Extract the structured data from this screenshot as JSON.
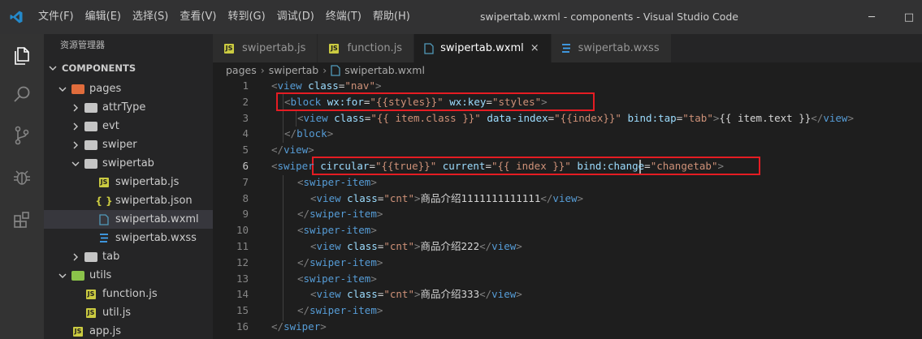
{
  "titlebar": {
    "menu": [
      "文件(F)",
      "编辑(E)",
      "选择(S)",
      "查看(V)",
      "转到(G)",
      "调试(D)",
      "终端(T)",
      "帮助(H)"
    ],
    "window_title": "swipertab.wxml - components - Visual Studio Code",
    "minimize": "─",
    "restore": "□"
  },
  "sidebar": {
    "title": "资源管理器",
    "section": "COMPONENTS",
    "tree": [
      {
        "label": "pages",
        "kind": "folder-pages",
        "expanded": true,
        "depth": 1
      },
      {
        "label": "attrType",
        "kind": "folder",
        "expanded": false,
        "depth": 2
      },
      {
        "label": "evt",
        "kind": "folder",
        "expanded": false,
        "depth": 2
      },
      {
        "label": "swiper",
        "kind": "folder",
        "expanded": false,
        "depth": 2
      },
      {
        "label": "swipertab",
        "kind": "folder",
        "expanded": true,
        "depth": 2
      },
      {
        "label": "swipertab.js",
        "kind": "js",
        "depth": 3
      },
      {
        "label": "swipertab.json",
        "kind": "json",
        "depth": 3
      },
      {
        "label": "swipertab.wxml",
        "kind": "wxml",
        "depth": 3,
        "selected": true
      },
      {
        "label": "swipertab.wxss",
        "kind": "wxss",
        "depth": 3
      },
      {
        "label": "tab",
        "kind": "folder",
        "expanded": false,
        "depth": 2
      },
      {
        "label": "utils",
        "kind": "folder-utils",
        "expanded": true,
        "depth": 1
      },
      {
        "label": "function.js",
        "kind": "js",
        "depth": 2
      },
      {
        "label": "util.js",
        "kind": "js",
        "depth": 2
      },
      {
        "label": "app.js",
        "kind": "js",
        "depth": 1
      }
    ]
  },
  "tabs": [
    {
      "label": "swipertab.js",
      "kind": "js",
      "active": false
    },
    {
      "label": "function.js",
      "kind": "js",
      "active": false
    },
    {
      "label": "swipertab.wxml",
      "kind": "wxml",
      "active": true
    },
    {
      "label": "swipertab.wxss",
      "kind": "wxss",
      "active": false
    }
  ],
  "tab_close": "×",
  "breadcrumb": [
    "pages",
    "swipertab",
    "swipertab.wxml"
  ],
  "breadcrumb_sep": "›",
  "editor": {
    "current_line": 6,
    "lines": [
      {
        "n": "1",
        "tokens": [
          [
            "bracket",
            "<"
          ],
          [
            "tag",
            "view"
          ],
          [
            "txt",
            " "
          ],
          [
            "attr",
            "class"
          ],
          [
            "txt",
            "="
          ],
          [
            "str",
            "\"nav\""
          ],
          [
            "bracket",
            ">"
          ]
        ],
        "indent": 0
      },
      {
        "n": "2",
        "tokens": [
          [
            "bracket",
            "<"
          ],
          [
            "tag",
            "block"
          ],
          [
            "txt",
            " "
          ],
          [
            "attr",
            "wx:for"
          ],
          [
            "txt",
            "="
          ],
          [
            "str",
            "\"{{styles}}\""
          ],
          [
            "txt",
            " "
          ],
          [
            "attr",
            "wx:key"
          ],
          [
            "txt",
            "="
          ],
          [
            "str",
            "\"styles\""
          ],
          [
            "bracket",
            ">"
          ]
        ],
        "indent": 1
      },
      {
        "n": "3",
        "tokens": [
          [
            "bracket",
            "<"
          ],
          [
            "tag",
            "view"
          ],
          [
            "txt",
            " "
          ],
          [
            "attr",
            "class"
          ],
          [
            "txt",
            "="
          ],
          [
            "str",
            "\"{{ item.class }}\""
          ],
          [
            "txt",
            " "
          ],
          [
            "attr",
            "data-index"
          ],
          [
            "txt",
            "="
          ],
          [
            "str",
            "\"{{index}}\""
          ],
          [
            "txt",
            " "
          ],
          [
            "attr",
            "bind:tap"
          ],
          [
            "txt",
            "="
          ],
          [
            "str",
            "\"tab\""
          ],
          [
            "bracket",
            ">"
          ],
          [
            "txt",
            "{{ item.text }}"
          ],
          [
            "bracket",
            "</"
          ],
          [
            "tag",
            "view"
          ],
          [
            "bracket",
            ">"
          ]
        ],
        "indent": 2
      },
      {
        "n": "4",
        "tokens": [
          [
            "bracket",
            "</"
          ],
          [
            "tag",
            "block"
          ],
          [
            "bracket",
            ">"
          ]
        ],
        "indent": 1
      },
      {
        "n": "5",
        "tokens": [
          [
            "bracket",
            "</"
          ],
          [
            "tag",
            "view"
          ],
          [
            "bracket",
            ">"
          ]
        ],
        "indent": 0
      },
      {
        "n": "6",
        "tokens": [
          [
            "bracket",
            "<"
          ],
          [
            "tag",
            "swiper"
          ],
          [
            "txt",
            " "
          ],
          [
            "attr",
            "circular"
          ],
          [
            "txt",
            "="
          ],
          [
            "str",
            "\"{{true}}\""
          ],
          [
            "txt",
            " "
          ],
          [
            "attr",
            "current"
          ],
          [
            "txt",
            "="
          ],
          [
            "str",
            "\"{{ index }}\""
          ],
          [
            "txt",
            " "
          ],
          [
            "attr",
            "bind:change"
          ],
          [
            "txt",
            "="
          ],
          [
            "str",
            "\"changetab\""
          ],
          [
            "bracket",
            ">"
          ]
        ],
        "indent": 0
      },
      {
        "n": "7",
        "tokens": [
          [
            "bracket",
            "<"
          ],
          [
            "tag",
            "swiper-item"
          ],
          [
            "bracket",
            ">"
          ]
        ],
        "indent": 2
      },
      {
        "n": "8",
        "tokens": [
          [
            "bracket",
            "<"
          ],
          [
            "tag",
            "view"
          ],
          [
            "txt",
            " "
          ],
          [
            "attr",
            "class"
          ],
          [
            "txt",
            "="
          ],
          [
            "str",
            "\"cnt\""
          ],
          [
            "bracket",
            ">"
          ],
          [
            "txt",
            "商品介绍1111111111111"
          ],
          [
            "bracket",
            "</"
          ],
          [
            "tag",
            "view"
          ],
          [
            "bracket",
            ">"
          ]
        ],
        "indent": 3
      },
      {
        "n": "9",
        "tokens": [
          [
            "bracket",
            "</"
          ],
          [
            "tag",
            "swiper-item"
          ],
          [
            "bracket",
            ">"
          ]
        ],
        "indent": 2
      },
      {
        "n": "10",
        "tokens": [
          [
            "bracket",
            "<"
          ],
          [
            "tag",
            "swiper-item"
          ],
          [
            "bracket",
            ">"
          ]
        ],
        "indent": 2
      },
      {
        "n": "11",
        "tokens": [
          [
            "bracket",
            "<"
          ],
          [
            "tag",
            "view"
          ],
          [
            "txt",
            " "
          ],
          [
            "attr",
            "class"
          ],
          [
            "txt",
            "="
          ],
          [
            "str",
            "\"cnt\""
          ],
          [
            "bracket",
            ">"
          ],
          [
            "txt",
            "商品介绍222"
          ],
          [
            "bracket",
            "</"
          ],
          [
            "tag",
            "view"
          ],
          [
            "bracket",
            ">"
          ]
        ],
        "indent": 3
      },
      {
        "n": "12",
        "tokens": [
          [
            "bracket",
            "</"
          ],
          [
            "tag",
            "swiper-item"
          ],
          [
            "bracket",
            ">"
          ]
        ],
        "indent": 2
      },
      {
        "n": "13",
        "tokens": [
          [
            "bracket",
            "<"
          ],
          [
            "tag",
            "swiper-item"
          ],
          [
            "bracket",
            ">"
          ]
        ],
        "indent": 2
      },
      {
        "n": "14",
        "tokens": [
          [
            "bracket",
            "<"
          ],
          [
            "tag",
            "view"
          ],
          [
            "txt",
            " "
          ],
          [
            "attr",
            "class"
          ],
          [
            "txt",
            "="
          ],
          [
            "str",
            "\"cnt\""
          ],
          [
            "bracket",
            ">"
          ],
          [
            "txt",
            "商品介绍333"
          ],
          [
            "bracket",
            "</"
          ],
          [
            "tag",
            "view"
          ],
          [
            "bracket",
            ">"
          ]
        ],
        "indent": 3
      },
      {
        "n": "15",
        "tokens": [
          [
            "bracket",
            "</"
          ],
          [
            "tag",
            "swiper-item"
          ],
          [
            "bracket",
            ">"
          ]
        ],
        "indent": 2
      },
      {
        "n": "16",
        "tokens": [
          [
            "bracket",
            "</"
          ],
          [
            "tag",
            "swiper"
          ],
          [
            "bracket",
            ">"
          ]
        ],
        "indent": 0
      }
    ]
  },
  "colors": {
    "titlebar": "#323233",
    "activitybar": "#333333",
    "sidebar": "#252526",
    "editor": "#1e1e1e",
    "annotation_box": "#e51c23",
    "vscode_blue": "#2489ca"
  },
  "icons": {
    "activity": [
      "files-icon",
      "search-icon",
      "source-control-icon",
      "debug-icon",
      "extensions-icon"
    ]
  }
}
